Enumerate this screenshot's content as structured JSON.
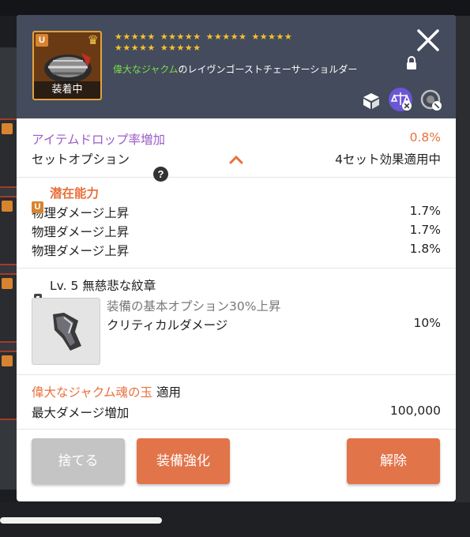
{
  "item": {
    "rank_badge": "U",
    "equipped_label": "装着中",
    "stars": [
      "★★★★★",
      "★★★★★",
      "★★★★★",
      "★★★★★",
      "★★★★★",
      "★★★★★"
    ],
    "name_prefix": "偉大なジャクム",
    "name_rest": "のレイヴンゴーストチェーサーショルダー"
  },
  "drop": {
    "label": "アイテムドロップ率増加",
    "value": "0.8%",
    "set_label": "セットオプション",
    "help_glyph": "?",
    "set_status": "4セット効果適用中"
  },
  "potential": {
    "badge": "U",
    "title": "潜在能力",
    "lines": [
      {
        "label": "物理ダメージ上昇",
        "value": "1.7%"
      },
      {
        "label": "物理ダメージ上昇",
        "value": "1.7%"
      },
      {
        "label": "物理ダメージ上昇",
        "value": "1.8%"
      }
    ]
  },
  "emblem": {
    "title": "Lv. 5 無慈悲な紋章",
    "desc": "装備の基本オプション30%上昇",
    "stat_label": "クリティカルダメージ",
    "stat_value": "10%"
  },
  "soul": {
    "name": "偉大なジャクム魂の玉",
    "applied": "適用",
    "stat_label": "最大ダメージ増加",
    "stat_value": "100,000"
  },
  "buttons": {
    "discard": "捨てる",
    "enhance": "装備強化",
    "release": "解除"
  },
  "colors": {
    "header_bg": "#434b5c",
    "accent_orange": "#e2744a",
    "purple": "#9b5cc8",
    "star": "#f6c12a",
    "green": "#7fdc4a"
  }
}
